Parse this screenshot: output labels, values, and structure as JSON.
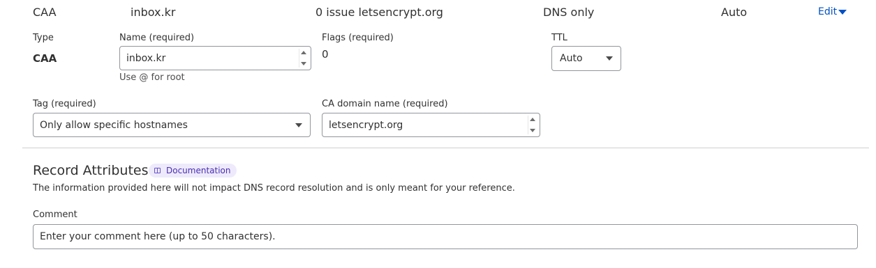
{
  "record_row": {
    "type": "CAA",
    "name": "inbox.kr",
    "content": "0 issue letsencrypt.org",
    "proxy_status": "DNS only",
    "ttl": "Auto",
    "edit_label": "Edit"
  },
  "form": {
    "type_label": "Type",
    "type_value": "CAA",
    "name_label": "Name (required)",
    "name_value": "inbox.kr",
    "name_help": "Use @ for root",
    "flags_label": "Flags (required)",
    "flags_value": "0",
    "ttl_label": "TTL",
    "ttl_value": "Auto",
    "tag_label": "Tag (required)",
    "tag_value": "Only allow specific hostnames",
    "ca_label": "CA domain name (required)",
    "ca_value": "letsencrypt.org"
  },
  "attributes": {
    "title": "Record Attributes",
    "doc_label": "Documentation",
    "description": "The information provided here will not impact DNS record resolution and is only meant for your reference.",
    "comment_label": "Comment",
    "comment_placeholder": "Enter your comment here (up to 50 characters)."
  },
  "icons": {
    "edit_caret": "caret-down-icon",
    "doc": "book-icon"
  }
}
